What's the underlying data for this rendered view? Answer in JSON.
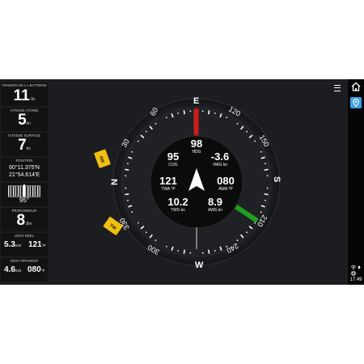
{
  "sidebar": {
    "battery": {
      "label": "TENSION DE LA BATTERIE",
      "value": "11",
      "unit": ".9v"
    },
    "sog": {
      "label": "VITESSE (FOND)",
      "value": "5",
      "unit": "kn"
    },
    "stw": {
      "label": "VITESSE SURFACE",
      "value": "7",
      "unit": "kn"
    },
    "position": {
      "label": "POSITION",
      "lat": "60°11.375'N",
      "lon": "21°54.614'E"
    },
    "heading_tape": {
      "value": "95°"
    },
    "depth": {
      "label": "PROFONDEUR",
      "value": "8",
      "unit": ".8m"
    },
    "true_wind": {
      "label": "VENT RÉEL",
      "speed": "5.3",
      "speed_unit": "m/s",
      "angle": "121",
      "angle_unit": "°P"
    },
    "apparent_wind": {
      "label": "VENT APPARENT",
      "speed": "4.6",
      "speed_unit": "m/s",
      "angle": "080",
      "angle_unit": "°P"
    }
  },
  "compass": {
    "cardinals": {
      "north": "N",
      "east": "E",
      "south": "S",
      "west": "W"
    },
    "degree_labels": [
      "30",
      "60",
      "120",
      "150",
      "210",
      "240",
      "300",
      "330"
    ],
    "aw_tag": "AW",
    "tw_tag": "TW",
    "center": {
      "hdg": {
        "value": "98",
        "label": "HDG"
      },
      "cog": {
        "value": "95",
        "label": "COG"
      },
      "vmg": {
        "value": "-3.6",
        "label": "VMG kn"
      },
      "twa": {
        "value": "121",
        "label": "TWA °P"
      },
      "awa": {
        "value": "080",
        "label": "AWA °P"
      },
      "tws": {
        "value": "10.2",
        "label": "TWS kn"
      },
      "aws": {
        "value": "8.9",
        "label": "AWS kn"
      }
    }
  },
  "status": {
    "time": "17:49"
  },
  "icons": {
    "menu": "menu-icon",
    "home": "home-icon",
    "map": "map-pin-icon",
    "wifi": "wifi-icon",
    "gps": "gps-icon",
    "gear": "gear-icon"
  },
  "colors": {
    "port": "#d01818",
    "starboard": "#1fa01f",
    "wind_tag": "#f0c010",
    "background": "#1c1d20"
  }
}
